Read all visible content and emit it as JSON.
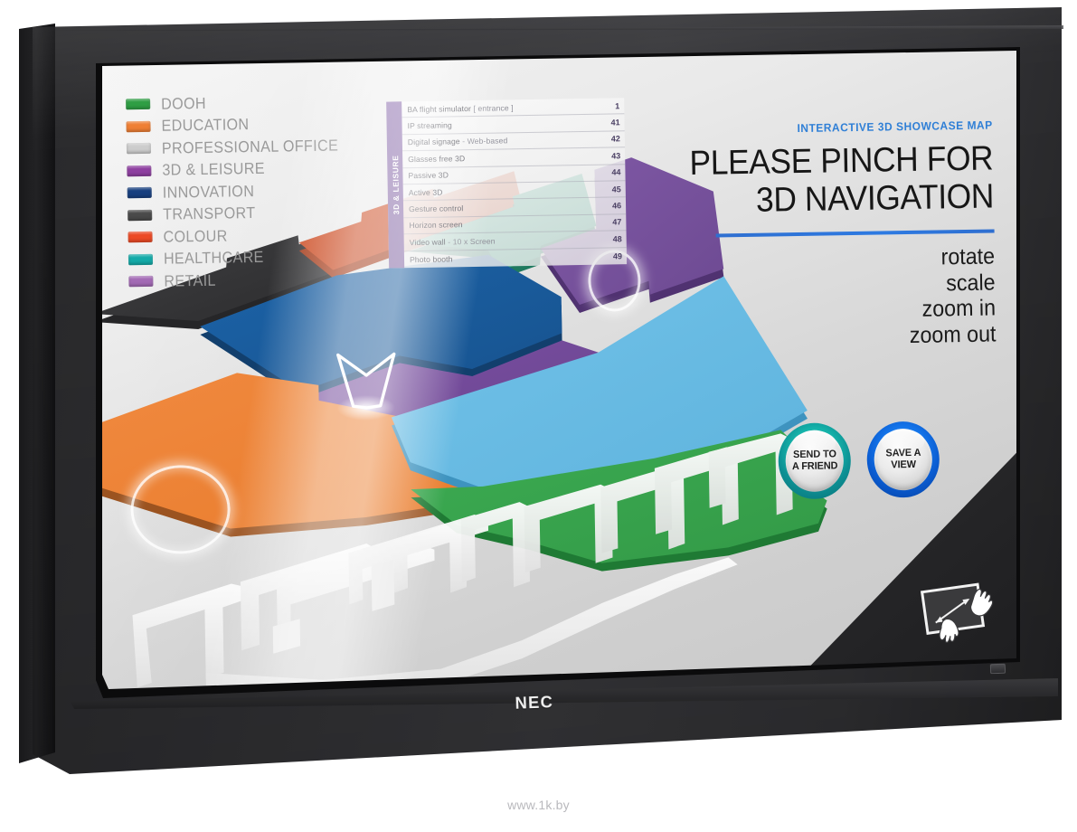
{
  "product": {
    "brand": "NEC"
  },
  "watermark": "www.1k.by",
  "screen": {
    "legend": {
      "items": [
        {
          "label": "DOOH",
          "color": "#2f9e44"
        },
        {
          "label": "EDUCATION",
          "color": "#ef7f34"
        },
        {
          "label": "PROFESSIONAL OFFICE",
          "color": "#cccccc"
        },
        {
          "label": "3D & LEISURE",
          "color": "#8e3fa0"
        },
        {
          "label": "INNOVATION",
          "color": "#173f7f"
        },
        {
          "label": "TRANSPORT",
          "color": "#4a4a4a"
        },
        {
          "label": "COLOUR",
          "color": "#ec4a25"
        },
        {
          "label": "HEALTHCARE",
          "color": "#14aaa8"
        },
        {
          "label": "RETAIL",
          "color": "#a36ab5"
        }
      ]
    },
    "info_table": {
      "category": "3D & LEISURE",
      "category_color": "#8d6fae",
      "rows": [
        {
          "name": "BA flight simulator",
          "note": "[ entrance ]",
          "number": "1"
        },
        {
          "name": "IP streaming",
          "note": "",
          "number": "41"
        },
        {
          "name": "Digital signage",
          "note": "-  Web-based",
          "number": "42"
        },
        {
          "name": "Glasses free 3D",
          "note": "",
          "number": "43"
        },
        {
          "name": "Passive 3D",
          "note": "",
          "number": "44"
        },
        {
          "name": "Active 3D",
          "note": "",
          "number": "45"
        },
        {
          "name": "Gesture control",
          "note": "",
          "number": "46"
        },
        {
          "name": "Horizon screen",
          "note": "",
          "number": "47"
        },
        {
          "name": "Video wall",
          "note": "-  10 x Screen",
          "number": "48"
        },
        {
          "name": "Photo booth",
          "note": "",
          "number": "49"
        }
      ]
    },
    "panel": {
      "kicker": "INTERACTIVE 3D SHOWCASE MAP",
      "headline_line1": "PLEASE PINCH FOR",
      "headline_line2": "3D NAVIGATION",
      "rule_color": "#2d7ae2",
      "actions": [
        "rotate",
        "scale",
        "zoom in",
        "zoom out"
      ]
    },
    "buttons": [
      {
        "line1": "SEND TO",
        "line2": "A FRIEND",
        "ring_color": "#16b5ab"
      },
      {
        "line1": "SAVE A",
        "line2": "VIEW",
        "ring_color": "#1577ec"
      }
    ],
    "gesture_hint": "pinch-gesture-icon"
  }
}
